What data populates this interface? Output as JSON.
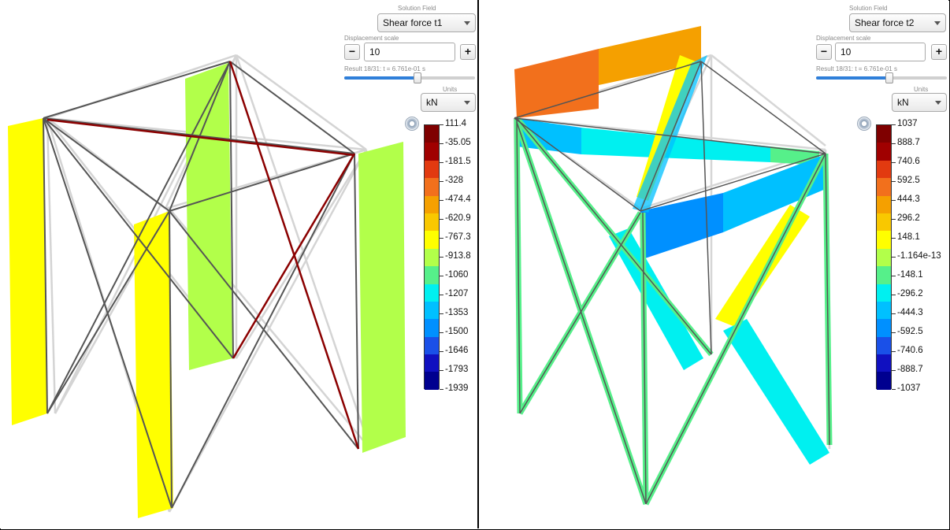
{
  "left_panel": {
    "solution_field_label": "Solution Field",
    "solution_field_value": "Shear force t1",
    "displacement_scale_label": "Displacement scale",
    "displacement_scale_value": "10",
    "minus_label": "−",
    "plus_label": "+",
    "result_label": "Result 18/31: t = 6.761e-01 s",
    "result_slider_fraction": 0.55,
    "units_label": "Units",
    "units_value": "kN",
    "legend_values": [
      "111.4",
      "-35.05",
      "-181.5",
      "-328",
      "-474.4",
      "-620.9",
      "-767.3",
      "-913.8",
      "-1060",
      "-1207",
      "-1353",
      "-1500",
      "-1646",
      "-1793",
      "-1939"
    ]
  },
  "right_panel": {
    "solution_field_label": "Solution Field",
    "solution_field_value": "Shear force t2",
    "displacement_scale_label": "Displacement scale",
    "displacement_scale_value": "10",
    "minus_label": "−",
    "plus_label": "+",
    "result_label": "Result 18/31: t = 6.761e-01 s",
    "result_slider_fraction": 0.55,
    "units_label": "Units",
    "units_value": "kN",
    "legend_values": [
      "1037",
      "888.7",
      "740.6",
      "592.5",
      "444.3",
      "296.2",
      "148.1",
      "-1.164e-13",
      "-148.1",
      "-296.2",
      "-444.3",
      "-592.5",
      "-740.6",
      "-888.7",
      "-1037"
    ]
  },
  "colormap": [
    "#7f0000",
    "#a00000",
    "#e23a10",
    "#f2701c",
    "#f5a000",
    "#f9c800",
    "#ffff00",
    "#b2ff4a",
    "#56f08a",
    "#00f0f0",
    "#00c0ff",
    "#0090ff",
    "#1a50e8",
    "#1010c0",
    "#00008f"
  ]
}
